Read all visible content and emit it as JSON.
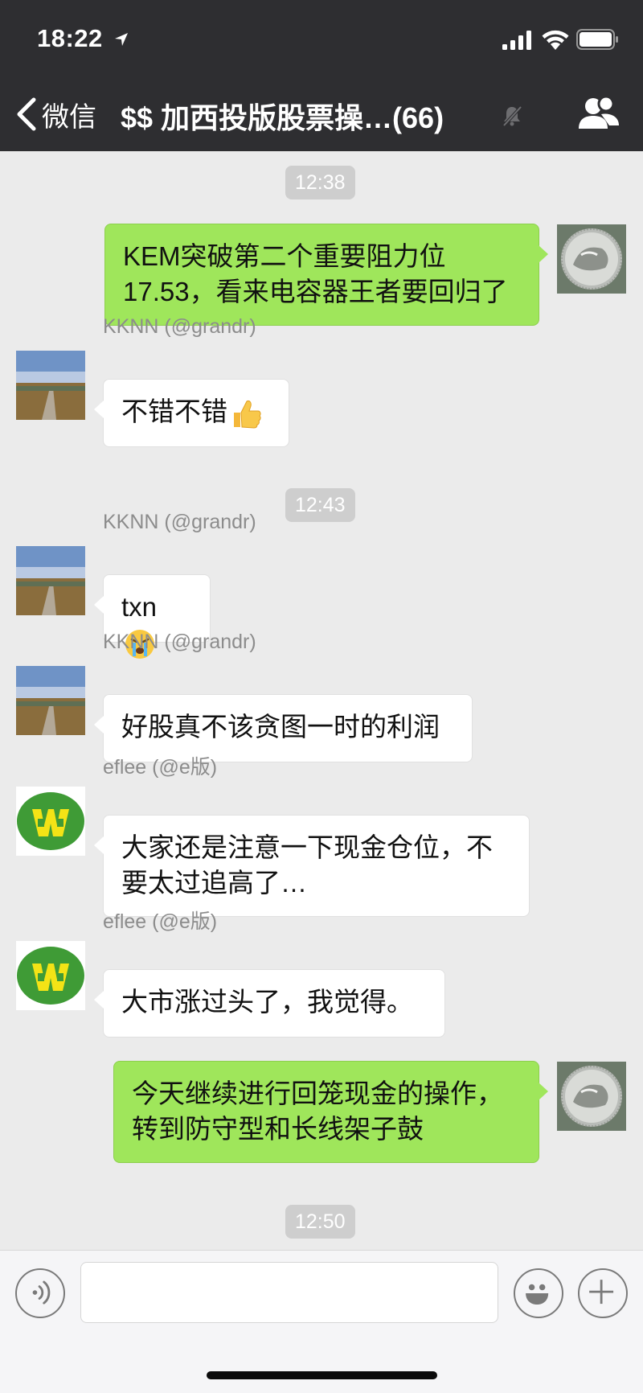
{
  "status_bar": {
    "time": "18:22",
    "icons": [
      "location-arrow-icon",
      "cellular-signal-icon",
      "wifi-icon",
      "battery-icon"
    ]
  },
  "nav": {
    "back_label": "微信",
    "title": "$$ 加西投版股票操…(66)",
    "mute_icon": "mute-bell-icon",
    "members_icon": "group-members-icon"
  },
  "messages": {
    "time_1": "12:38",
    "m1": {
      "text": "KEM突破第二个重要阻力位17.53，看来电容器王者要回归了"
    },
    "m2": {
      "sender": "KKNN (@grandr)",
      "text": "不错不错",
      "emoji": "thumbs-up-icon"
    },
    "time_2": "12:43",
    "m3": {
      "sender": "KKNN (@grandr)",
      "text": "txn",
      "emoji": "crying-face-icon"
    },
    "m4": {
      "sender": "KKNN (@grandr)",
      "text": "好股真不该贪图一时的利润"
    },
    "m5": {
      "sender": "eflee (@e版)",
      "text": "大家还是注意一下现金仓位，不要太过追高了…"
    },
    "m6": {
      "sender": "eflee (@e版)",
      "text": "大市涨过头了，我觉得。"
    },
    "m7": {
      "text": "今天继续进行回笼现金的操作，转到防守型和长线架子鼓"
    },
    "time_3": "12:50"
  },
  "input_bar": {
    "voice_icon": "voice-input-icon",
    "emoji_icon": "smiley-icon",
    "plus_icon": "plus-icon",
    "message_value": ""
  },
  "colors": {
    "header_bg": "#2e2e31",
    "chat_bg": "#ebebeb",
    "outgoing_bubble": "#9fe65b",
    "incoming_bubble": "#ffffff",
    "time_pill": "#cecece"
  }
}
